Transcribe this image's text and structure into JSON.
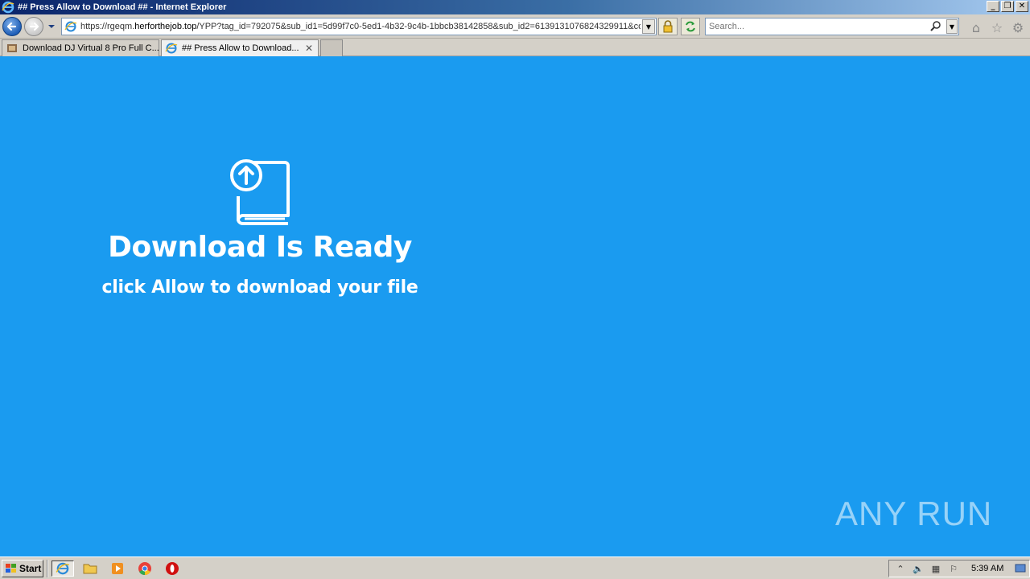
{
  "window": {
    "title": "## Press Allow to Download ## - Internet Explorer",
    "controls": [
      "minimize",
      "restore",
      "close"
    ]
  },
  "navbar": {
    "url_prefix": "https://rgeqm.",
    "url_domain": "herforthejob.top",
    "url_rest": "/YPP?tag_id=792075&sub_id1=5d99f7c0-5ed1-4b32-9c4b-1bbcb38142858&sub_id2=6139131076824329911&coo",
    "search_placeholder": "Search..."
  },
  "tabs": [
    {
      "label": "Download DJ Virtual 8 Pro Full C...",
      "active": false
    },
    {
      "label": "## Press Allow to Download...",
      "active": true
    }
  ],
  "page": {
    "headline": "Download Is Ready",
    "subline": "click Allow to download your file",
    "background": "#1a9bf0",
    "watermark": "ANY RUN"
  },
  "taskbar": {
    "start_label": "Start",
    "clock": "5:39 AM"
  }
}
